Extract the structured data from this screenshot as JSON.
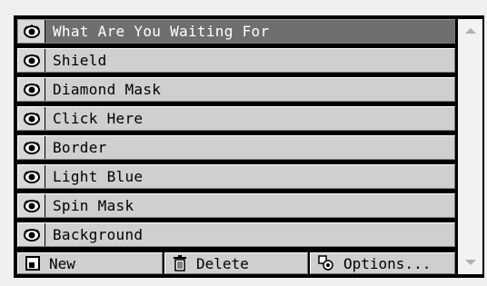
{
  "layers": [
    {
      "label": "What Are You Waiting For",
      "selected": true
    },
    {
      "label": "Shield",
      "selected": false
    },
    {
      "label": "Diamond Mask",
      "selected": false
    },
    {
      "label": "Click Here",
      "selected": false
    },
    {
      "label": "Border",
      "selected": false
    },
    {
      "label": "Light Blue",
      "selected": false
    },
    {
      "label": "Spin Mask",
      "selected": false
    },
    {
      "label": "Background",
      "selected": false
    }
  ],
  "toolbar": {
    "new_label": "New",
    "delete_label": "Delete",
    "options_label": "Options..."
  },
  "icons": {
    "visibility": "eye-icon",
    "new": "new-layer-icon",
    "delete": "trash-icon",
    "options": "options-icon",
    "scroll_up": "scroll-up-arrow-icon",
    "scroll_down": "scroll-down-arrow-icon"
  },
  "colors": {
    "row_bg": "#cfcfcf",
    "selected_row_bg": "#6f6f6f",
    "selected_text": "#ffffff"
  }
}
